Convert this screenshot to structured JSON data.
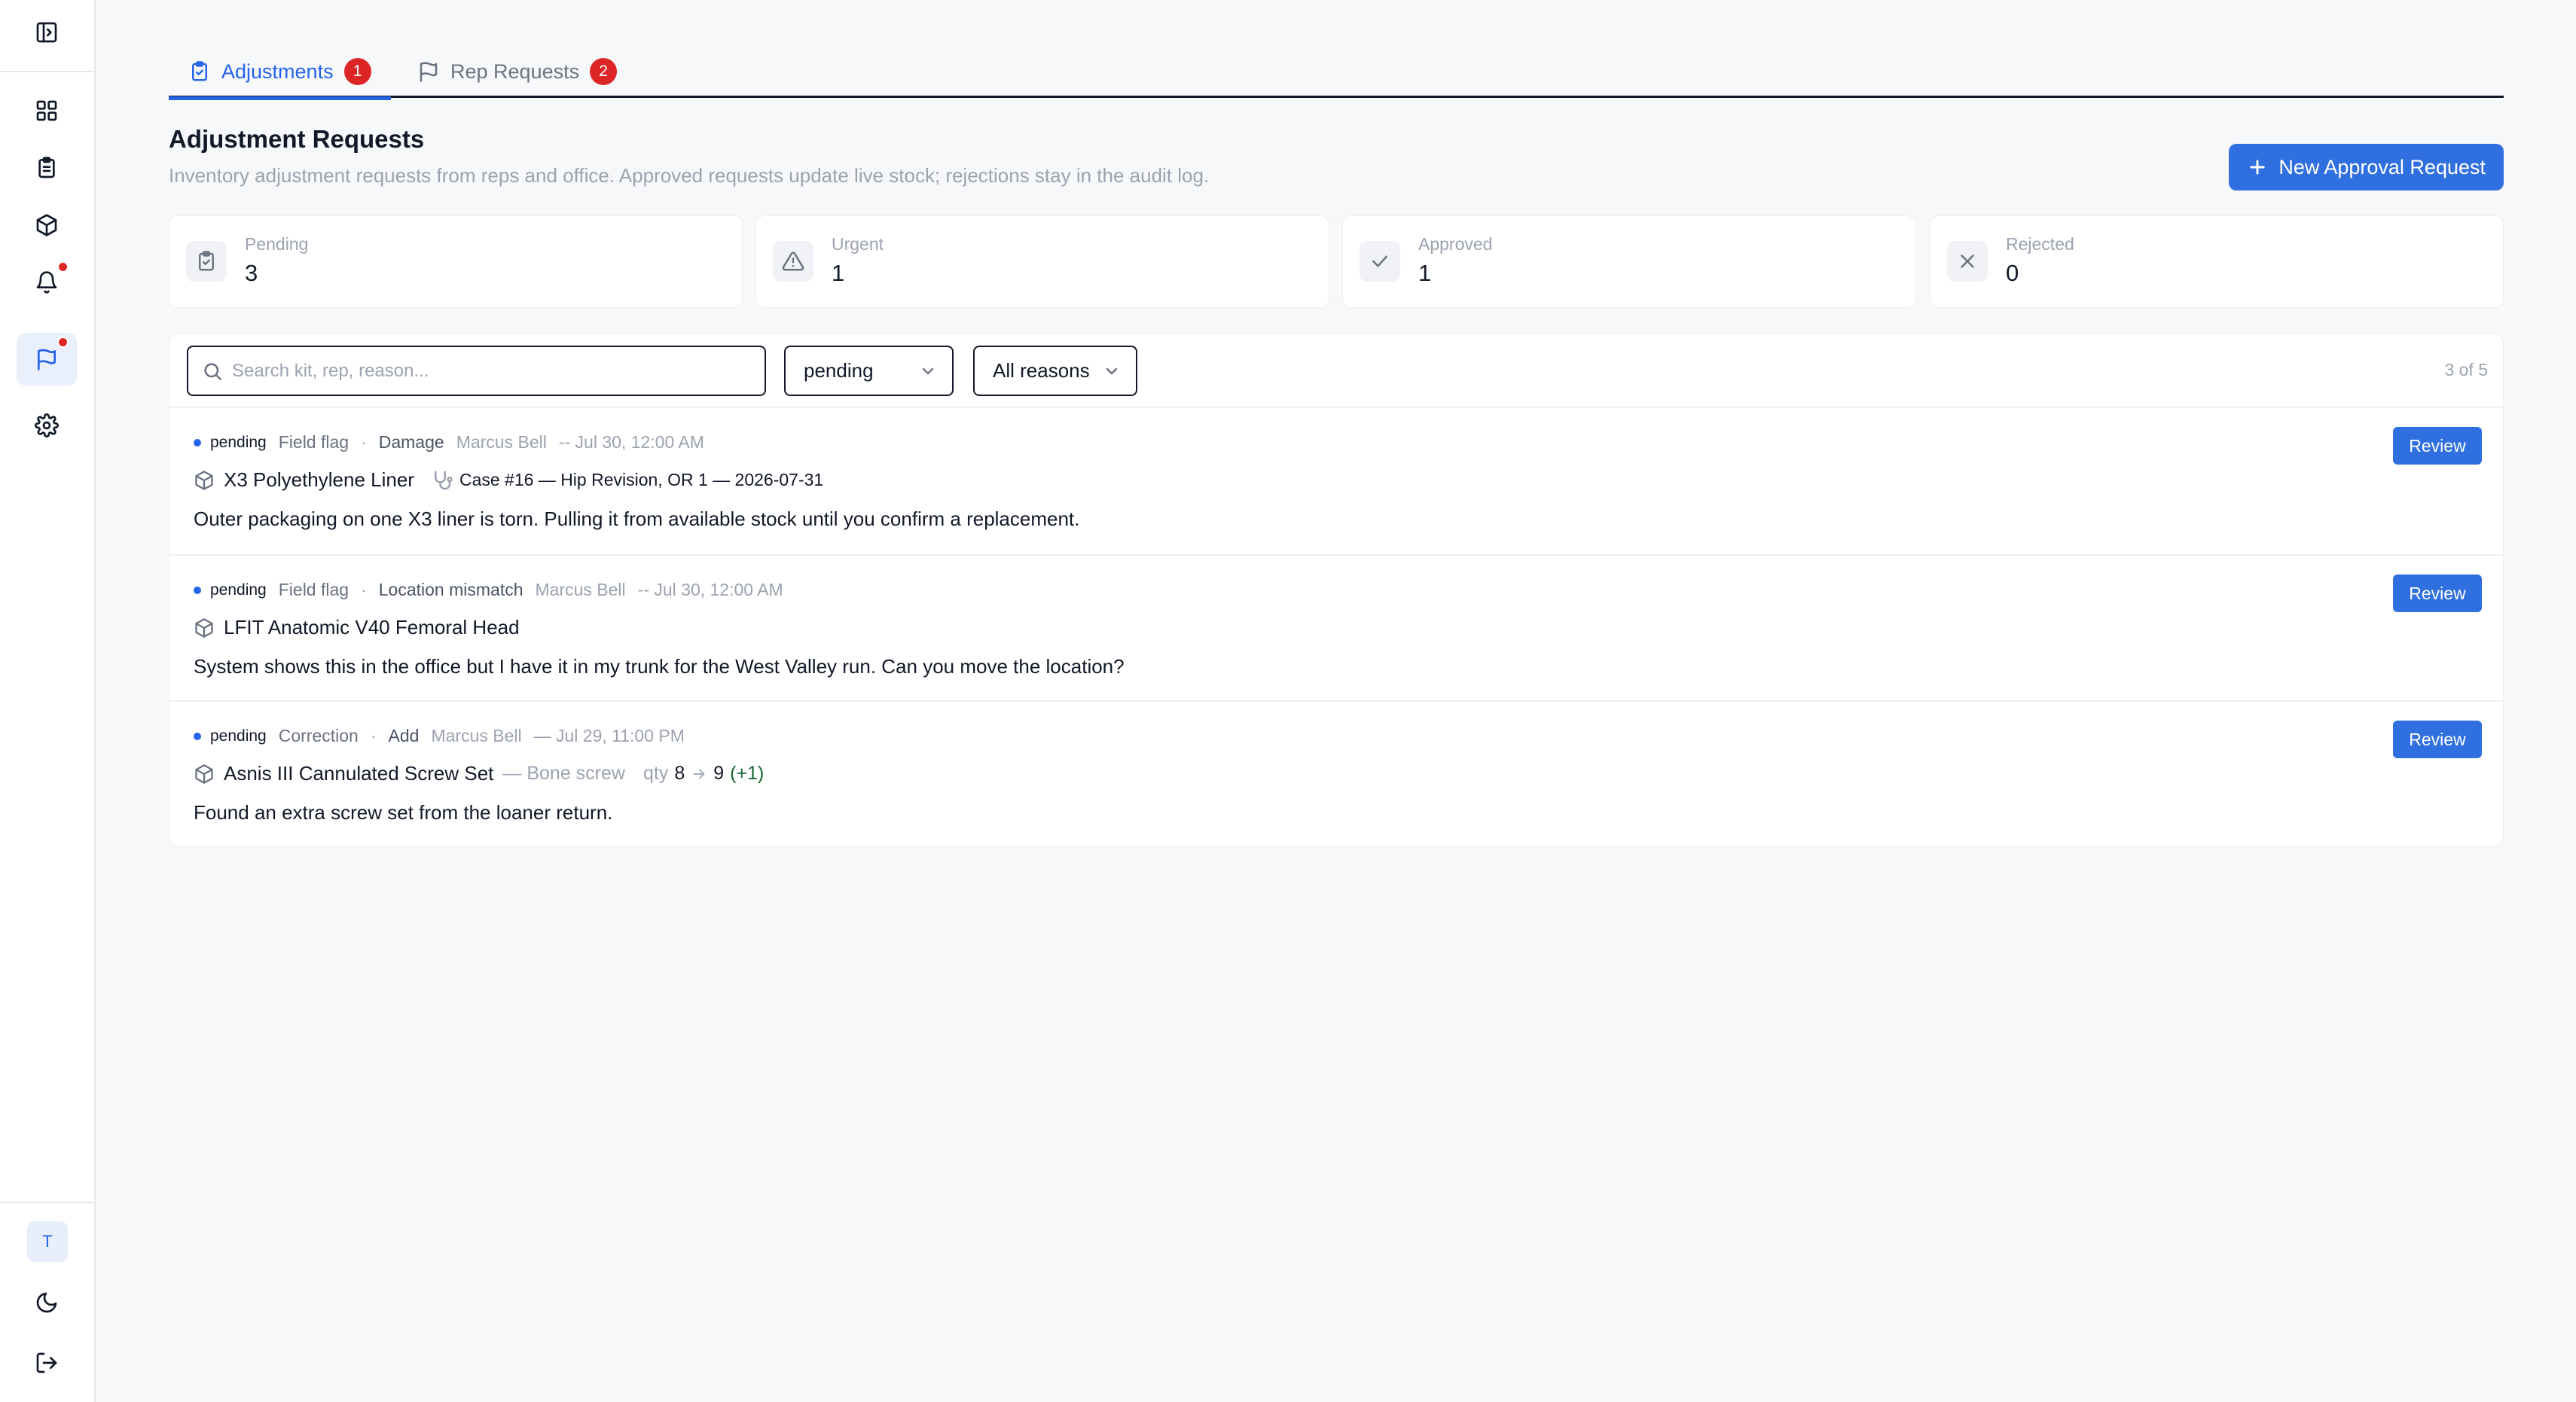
{
  "sidebar": {
    "icons": [
      "sidebar-toggle-icon",
      "dashboard-icon",
      "clipboard-icon",
      "package-icon",
      "bell-icon",
      "flag-icon",
      "settings-icon",
      "moon-icon",
      "logout-icon"
    ],
    "avatar_initial": "T"
  },
  "tabs": [
    {
      "label": "Adjustments",
      "badge": "1",
      "active": true
    },
    {
      "label": "Rep Requests",
      "badge": "2",
      "active": false
    }
  ],
  "header": {
    "title": "Adjustment Requests",
    "subtitle": "Inventory adjustment requests from reps and office. Approved requests update live stock; rejections stay in the audit log.",
    "new_button_label": "New Approval Request"
  },
  "stats": [
    {
      "label": "Pending",
      "value": "3",
      "icon": "clipboard-check-icon"
    },
    {
      "label": "Urgent",
      "value": "1",
      "icon": "warning-icon"
    },
    {
      "label": "Approved",
      "value": "1",
      "icon": "check-icon"
    },
    {
      "label": "Rejected",
      "value": "0",
      "icon": "x-icon"
    }
  ],
  "filters": {
    "search_placeholder": "Search kit, rep, reason...",
    "status_value": "pending",
    "reason_value": "All reasons",
    "count": "3 of 5"
  },
  "requests": [
    {
      "status": "pending",
      "type": "Field flag",
      "separator": "·",
      "reason": "Damage",
      "rep": "Marcus Bell",
      "time": "-- Jul 30, 12:00 AM",
      "item": "X3 Polyethylene Liner",
      "case": "Case #16 — Hip Revision, OR 1 — 2026-07-31",
      "message": "Outer packaging on one X3 liner is torn. Pulling it from available stock until you confirm a replacement.",
      "action": "Review"
    },
    {
      "status": "pending",
      "type": "Field flag",
      "separator": "·",
      "reason": "Location mismatch",
      "rep": "Marcus Bell",
      "time": "-- Jul 30, 12:00 AM",
      "item": "LFIT Anatomic V40 Femoral Head",
      "message": "System shows this in the office but I have it in my trunk for the West Valley run. Can you move the location?",
      "action": "Review"
    },
    {
      "status": "pending",
      "type": "Correction",
      "separator": "·",
      "reason": "Add",
      "rep": "Marcus Bell",
      "time": "— Jul 29, 11:00 PM",
      "item": "Asnis III Cannulated Screw Set",
      "item_sub": "— Bone screw",
      "qty_label": "qty",
      "qty_from": "8",
      "qty_to": "9",
      "qty_delta": "(+1)",
      "message": "Found an extra screw set from the loaner return.",
      "action": "Review"
    }
  ],
  "colors": {
    "accent": "#2f6fdf",
    "badge": "#dc2626",
    "positive": "#166534"
  }
}
